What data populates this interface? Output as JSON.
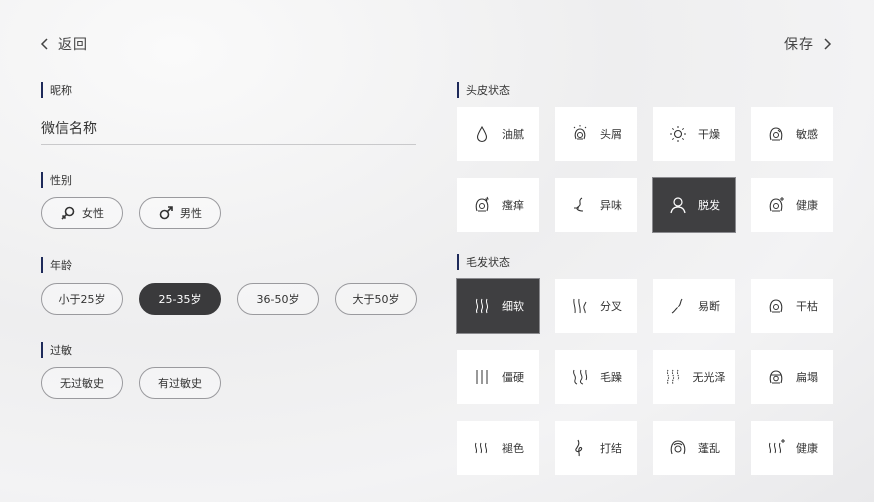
{
  "nav": {
    "back_label": "返回",
    "save_label": "保存"
  },
  "left": {
    "nickname": {
      "label": "昵称",
      "value": "微信名称"
    },
    "gender": {
      "label": "性别",
      "options": [
        "女性",
        "男性"
      ]
    },
    "age": {
      "label": "年龄",
      "options": [
        "小于25岁",
        "25-35岁",
        "36-50岁",
        "大于50岁"
      ],
      "selected": "25-35岁"
    },
    "allergy": {
      "label": "过敏",
      "options": [
        "无过敏史",
        "有过敏史"
      ]
    }
  },
  "right": {
    "scalp": {
      "label": "头皮状态",
      "items": [
        "油腻",
        "头屑",
        "干燥",
        "敏感",
        "瘙痒",
        "异味",
        "脱发",
        "健康"
      ],
      "icons": [
        "droplet-icon",
        "dandruff-head-icon",
        "sun-icon",
        "sensitive-head-icon",
        "itchy-head-icon",
        "odor-icon",
        "hair-loss-person-icon",
        "healthy-head-icon"
      ],
      "selected": "脱发"
    },
    "hair": {
      "label": "毛发状态",
      "items": [
        "细软",
        "分叉",
        "易断",
        "干枯",
        "僵硬",
        "毛躁",
        "无光泽",
        "扁塌",
        "褪色",
        "打结",
        "蓬乱",
        "健康"
      ],
      "icons": [
        "fine-hair-icon",
        "split-ends-icon",
        "broken-hair-icon",
        "dry-hair-head-icon",
        "stiff-hair-icon",
        "frizzy-hair-icon",
        "dull-hair-icon",
        "flat-hair-head-icon",
        "faded-hair-icon",
        "knot-icon",
        "messy-hair-head-icon",
        "healthy-hair-icon"
      ],
      "selected": "细软"
    }
  },
  "colors": {
    "accent_bar": "#1e2a5a",
    "selected_bg": "#3f3f41"
  }
}
